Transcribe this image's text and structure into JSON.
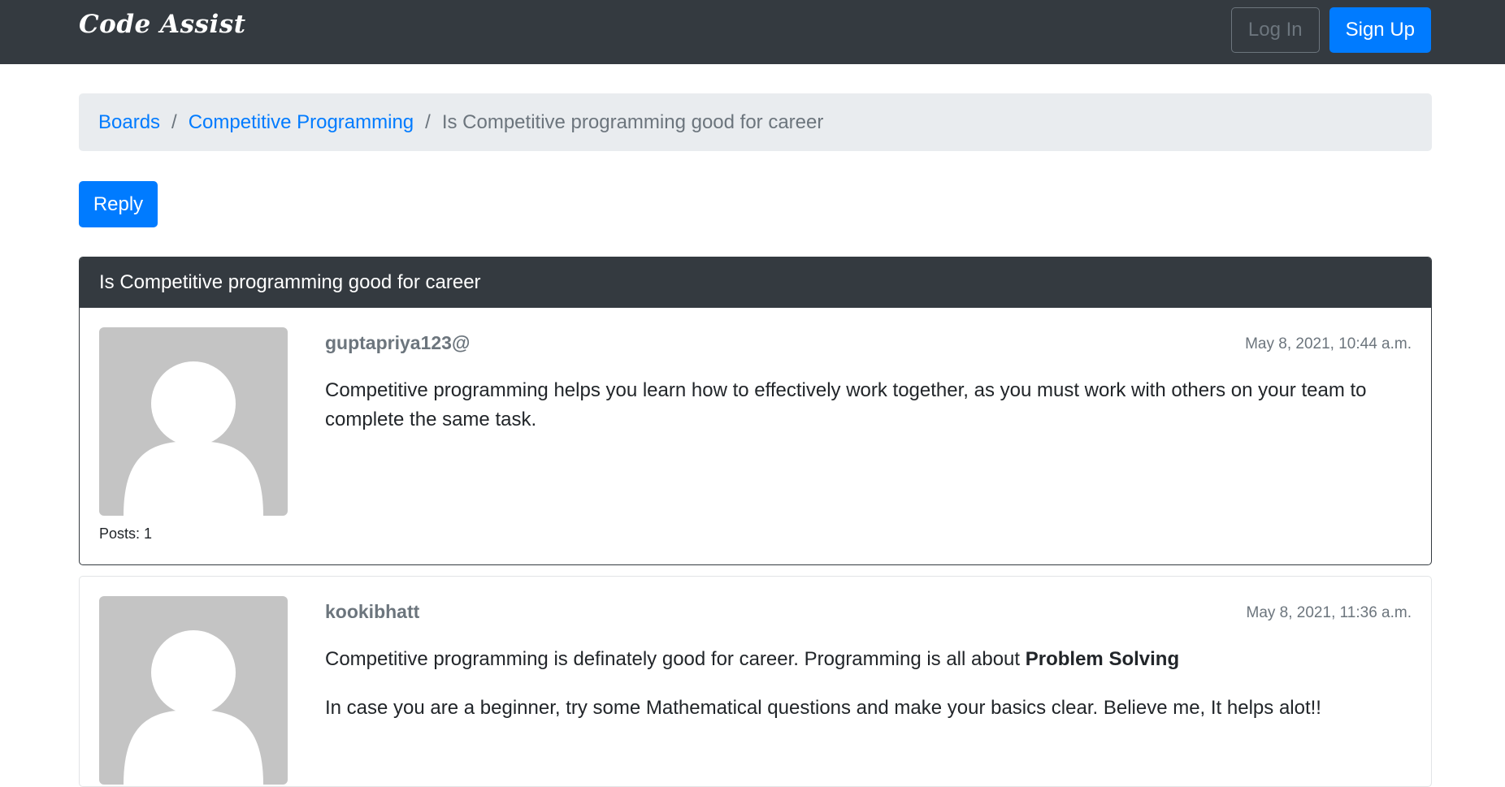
{
  "navbar": {
    "brand": "Code Assist",
    "login_label": "Log In",
    "signup_label": "Sign Up"
  },
  "breadcrumb": {
    "boards": "Boards",
    "separator": "/",
    "board": "Competitive Programming",
    "topic": "Is Competitive programming good for career"
  },
  "reply_label": "Reply",
  "topic": {
    "title": "Is Competitive programming good for career"
  },
  "posts": [
    {
      "author": "guptapriya123@",
      "date": "May 8, 2021, 10:44 a.m.",
      "message": "Competitive programming helps you learn how to effectively work together, as you must work with others on your team to complete the same task.",
      "posts_count": "Posts: 1"
    },
    {
      "author": "kookibhatt",
      "date": "May 8, 2021, 11:36 a.m.",
      "message_line1": "Competitive programming is definately good for career. Programming is all about ",
      "message_line1_bold": "Problem Solving",
      "message_line2": "In case you are a beginner, try some Mathematical questions and make your basics clear. Believe me, It helps alot!!"
    }
  ],
  "colors": {
    "navbar": "#343a40",
    "primary": "#007bff",
    "muted": "#6c757d",
    "breadcrumb_bg": "#e9ecef",
    "avatar": "#c4c4c4"
  }
}
